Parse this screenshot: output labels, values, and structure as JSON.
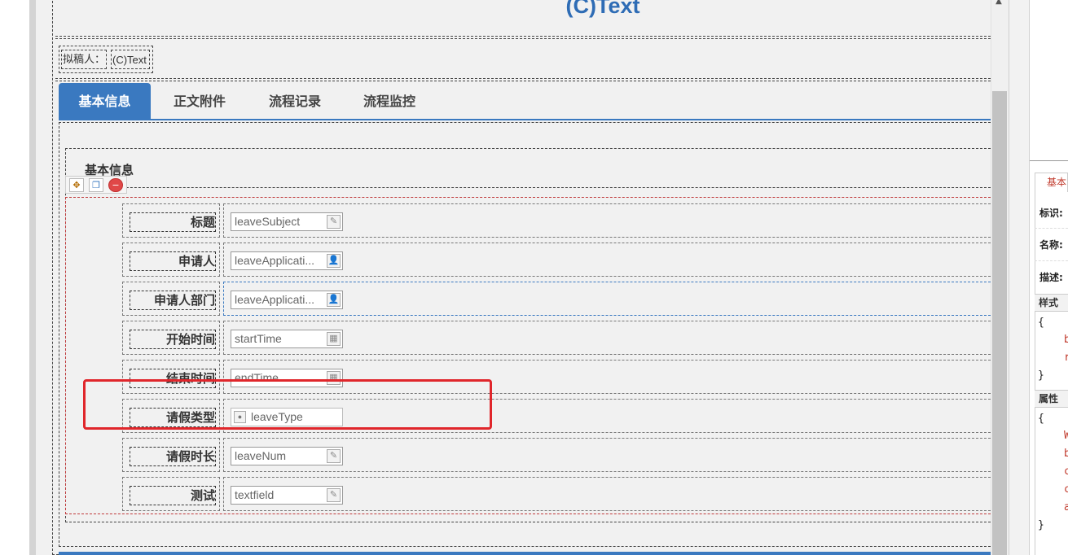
{
  "form": {
    "title": "(C)Text",
    "drafter_label": "拟稿人：",
    "drafter_value": "(C)Text"
  },
  "tabs": [
    {
      "label": "基本信息",
      "active": true
    },
    {
      "label": "正文附件",
      "active": false
    },
    {
      "label": "流程记录",
      "active": false
    },
    {
      "label": "流程监控",
      "active": false
    }
  ],
  "section": {
    "heading": "基本信息",
    "tools": [
      "move-icon",
      "copy-icon",
      "delete-icon"
    ]
  },
  "rows": [
    {
      "label": "标题",
      "value": "leaveSubject",
      "icon": "edit-icon"
    },
    {
      "label": "申请人",
      "value": "leaveApplicati...",
      "icon": "user-icon"
    },
    {
      "label": "申请人部门",
      "value": "leaveApplicati...",
      "icon": "user-icon"
    },
    {
      "label": "开始时间",
      "value": "startTime",
      "icon": "calendar-icon"
    },
    {
      "label": "结束时间",
      "value": "endTime",
      "icon": "calendar-icon"
    },
    {
      "label": "请假类型",
      "value": "leaveType",
      "icon": "radio-icon"
    },
    {
      "label": "请假时长",
      "value": "leaveNum",
      "icon": "edit-icon"
    },
    {
      "label": "测试",
      "value": "textfield",
      "icon": "edit-icon"
    }
  ],
  "right_panel": {
    "tab": "基本",
    "labels": [
      "标识:",
      "名称:",
      "描述:"
    ],
    "style_header": "样式",
    "attr_header": "属性",
    "style_code": [
      "{",
      "b",
      "r",
      "}"
    ],
    "attr_code": [
      "{",
      "W",
      "b",
      "c",
      "c",
      "a",
      "}"
    ]
  },
  "colors": {
    "accent": "#3a79c0",
    "title": "#2e6cb5",
    "highlight": "#e0262b",
    "canvas": "#f1f1f1"
  }
}
